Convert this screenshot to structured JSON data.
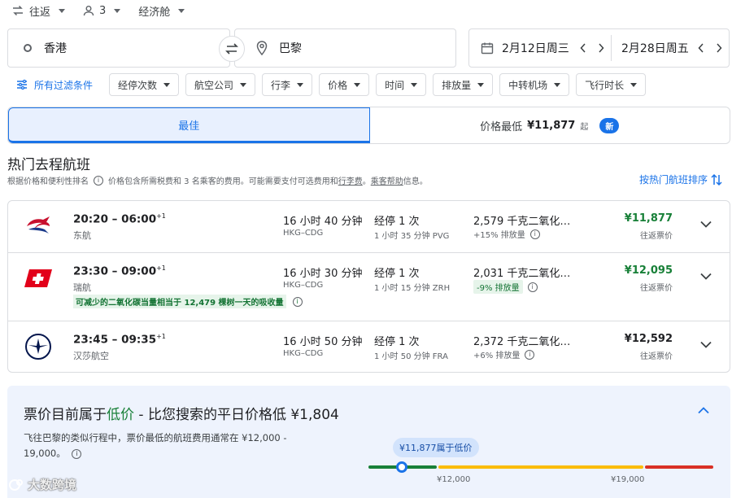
{
  "trip": {
    "type": "往返",
    "passengers": "3",
    "cabin": "经济舱"
  },
  "search": {
    "origin": "香港",
    "destination": "巴黎",
    "depart_date": "2月12日周三",
    "return_date": "2月28日周五"
  },
  "filters": {
    "all_label": "所有过滤条件",
    "chips": [
      "经停次数",
      "航空公司",
      "行李",
      "价格",
      "时间",
      "排放量",
      "中转机场",
      "飞行时长"
    ]
  },
  "tabs": {
    "best": "最佳",
    "cheapest_label": "价格最低",
    "cheapest_price": "¥11,877",
    "cheapest_suffix": "起",
    "new_badge": "新"
  },
  "results": {
    "title": "热门去程航班",
    "subtitle_a": "根据价格和便利性排名",
    "subtitle_b": "价格包含所需税费和 3 名乘客的费用。可能需要支付可选费用和",
    "subtitle_link1": "行李费",
    "subtitle_c": "。",
    "subtitle_link2": "乘客帮助",
    "subtitle_d": "信息。",
    "sort_label": "按热门航班排序"
  },
  "flights": [
    {
      "time": "20:20 – 06:00",
      "day_offset": "+1",
      "airline": "东航",
      "logo": "china-eastern-logo",
      "duration": "16 小时 40 分钟",
      "route": "HKG–CDG",
      "stops": "经停 1 次",
      "layover": "1 小时 35 分钟 PVG",
      "co2": "2,579 千克二氧化…",
      "co2_sub": "+15% 排放量",
      "co2_tag": false,
      "price": "¥11,877",
      "price_green": true,
      "price_sub": "往返票价",
      "eco_note": ""
    },
    {
      "time": "23:30 – 09:00",
      "day_offset": "+1",
      "airline": "瑞航",
      "logo": "swiss-logo",
      "duration": "16 小时 30 分钟",
      "route": "HKG–CDG",
      "stops": "经停 1 次",
      "layover": "1 小时 15 分钟 ZRH",
      "co2": "2,031 千克二氧化…",
      "co2_sub": "-9% 排放量",
      "co2_tag": true,
      "price": "¥12,095",
      "price_green": true,
      "price_sub": "往返票价",
      "eco_note": "可减少的二氧化碳当量相当于 12,479 棵树一天的吸收量"
    },
    {
      "time": "23:45 – 09:35",
      "day_offset": "+1",
      "airline": "汉莎航空",
      "logo": "lufthansa-logo",
      "duration": "16 小时 50 分钟",
      "route": "HKG–CDG",
      "stops": "经停 1 次",
      "layover": "1 小时 50 分钟 FRA",
      "co2": "2,372 千克二氧化…",
      "co2_sub": "+6% 排放量",
      "co2_tag": false,
      "price": "¥12,592",
      "price_green": false,
      "price_sub": "往返票价",
      "eco_note": ""
    }
  ],
  "insight": {
    "title_a": "票价目前属于",
    "title_low": "低价",
    "title_b": " - 比您搜索的平日价格低 ¥1,804",
    "desc": "飞往巴黎的类似行程中，票价最低的航班费用通常在 ¥12,000 - 19,000。",
    "bubble": "¥11,877属于低价",
    "tick_low": "¥12,000",
    "tick_high": "¥19,000",
    "current_price": 11877,
    "range_low": 12000,
    "range_high": 19000
  },
  "watermark": "大数跨境",
  "colors": {
    "accent": "#1a73e8",
    "green": "#188038",
    "yellow": "#fbbc04",
    "red": "#d93025"
  }
}
